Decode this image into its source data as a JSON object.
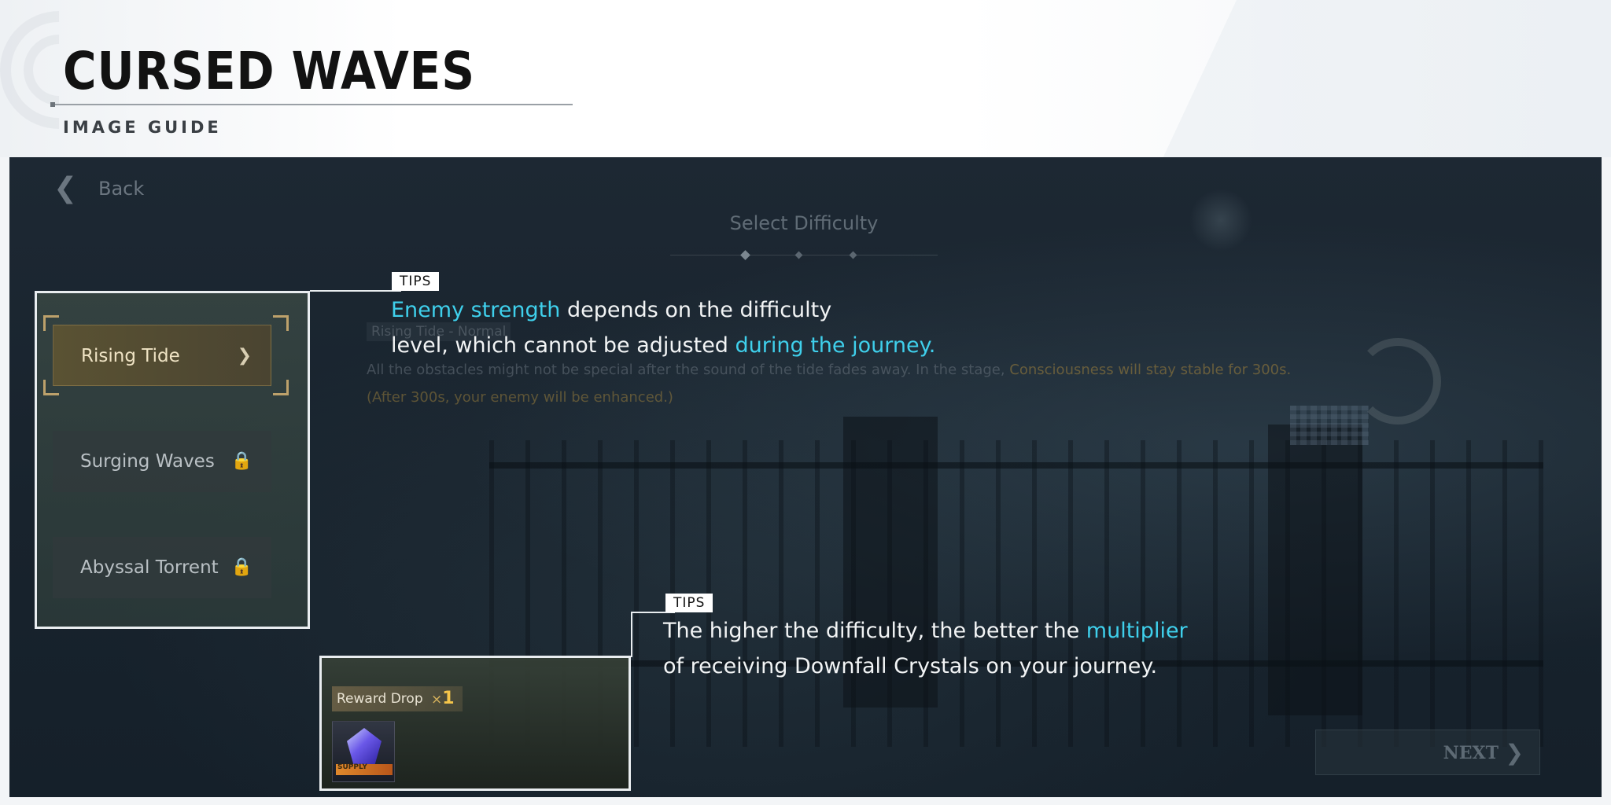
{
  "page": {
    "title": "CURSED WAVES",
    "subtitle": "IMAGE GUIDE"
  },
  "screen": {
    "back_label": "Back",
    "difficulty_title": "Select Difficulty",
    "stage_name": "Rising Tide - Normal",
    "description_start": "All the obstacles might not be special after the sound of the tide fades away.  In the stage, ",
    "description_highlight": "Consciousness will stay stable for 300s.",
    "description_note": "(After 300s, your enemy will be enhanced.)",
    "difficulties": [
      {
        "label": "Rising Tide",
        "icon": "chevron-right-icon",
        "state": "selected"
      },
      {
        "label": "Surging Waves",
        "icon": "lock-icon",
        "state": "locked"
      },
      {
        "label": "Abyssal Torrent",
        "icon": "lock-icon",
        "state": "locked"
      }
    ],
    "reward": {
      "label": "Reward Drop",
      "multiplier_prefix": "×",
      "multiplier_value": "1",
      "item_band": "SUPPLY"
    },
    "next_label": "NEXT"
  },
  "tips": [
    {
      "tag": "TIPS",
      "accent_1": "Enemy strength",
      "text_1": " depends on the difficulty",
      "text_2": "level, which cannot be adjusted ",
      "accent_2": "during the journey."
    },
    {
      "tag": "TIPS",
      "text_1": "The higher the difficulty, the better the ",
      "accent_1": "multiplier",
      "text_2": "of receiving Downfall Crystals on your journey."
    }
  ],
  "colors": {
    "accent": "#3fd0ec",
    "gold": "#d7b25c",
    "highlight_border": "#e9edf0"
  }
}
